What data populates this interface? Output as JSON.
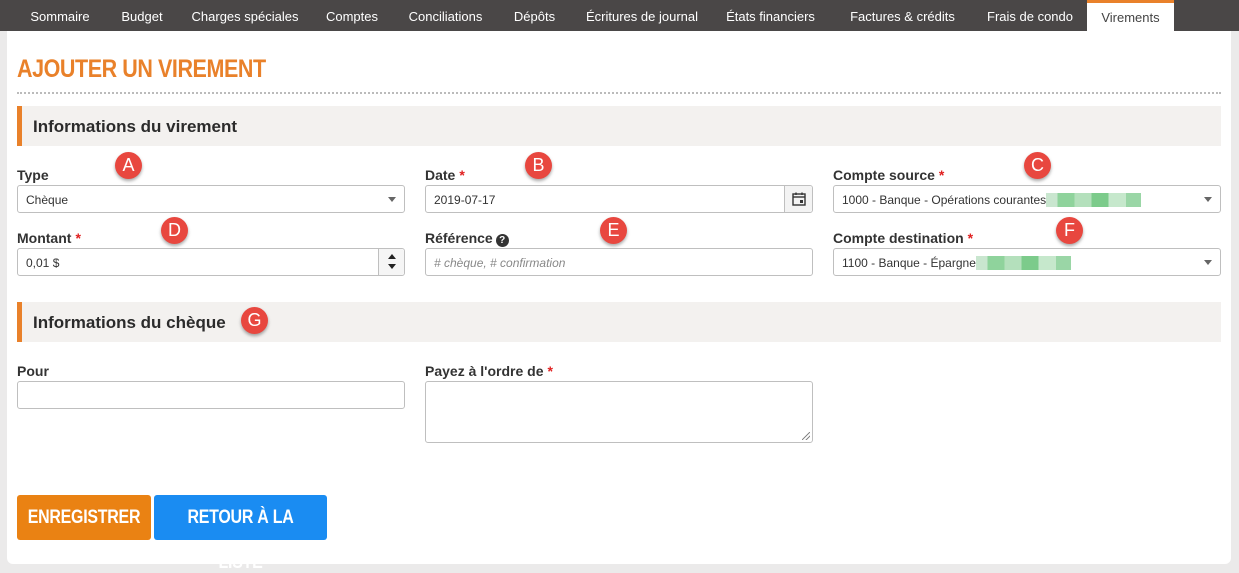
{
  "nav": {
    "tabs": [
      {
        "label": "Sommaire"
      },
      {
        "label": "Budget"
      },
      {
        "label": "Charges spéciales"
      },
      {
        "label": "Comptes"
      },
      {
        "label": "Conciliations"
      },
      {
        "label": "Dépôts"
      },
      {
        "label": "Écritures de journal"
      },
      {
        "label": "États financiers"
      },
      {
        "label": "Factures & crédits"
      },
      {
        "label": "Frais de condo"
      },
      {
        "label": "Virements"
      }
    ],
    "active": "Virements"
  },
  "page": {
    "title": "AJOUTER UN VIREMENT"
  },
  "sections": {
    "transfer": {
      "title": "Informations du virement"
    },
    "cheque": {
      "title": "Informations du chèque"
    }
  },
  "fields": {
    "type": {
      "label": "Type",
      "value": "Chèque"
    },
    "date": {
      "label": "Date",
      "required": "*",
      "value": "2019-07-17"
    },
    "source": {
      "label": "Compte source",
      "required": "*",
      "value": "1000 - Banque - Opérations courantes"
    },
    "amount": {
      "label": "Montant",
      "required": "*",
      "value": "0,01 $"
    },
    "reference": {
      "label": "Référence",
      "help": "?",
      "placeholder": "# chèque, # confirmation"
    },
    "destination": {
      "label": "Compte destination",
      "required": "*",
      "value": "1100 - Banque - Épargne"
    },
    "pour": {
      "label": "Pour",
      "value": ""
    },
    "payee": {
      "label": "Payez à l'ordre de",
      "required": "*",
      "value": ""
    }
  },
  "markers": [
    "A",
    "B",
    "C",
    "D",
    "E",
    "F",
    "G"
  ],
  "buttons": {
    "save": "ENREGISTRER",
    "back": "RETOUR À LA LISTE"
  },
  "colors": {
    "accent": "#e9812a",
    "save": "#ea8213",
    "back": "#1a8cf2",
    "required": "#e02020",
    "marker": "#e8473f",
    "nav_bg": "#4a4747"
  }
}
